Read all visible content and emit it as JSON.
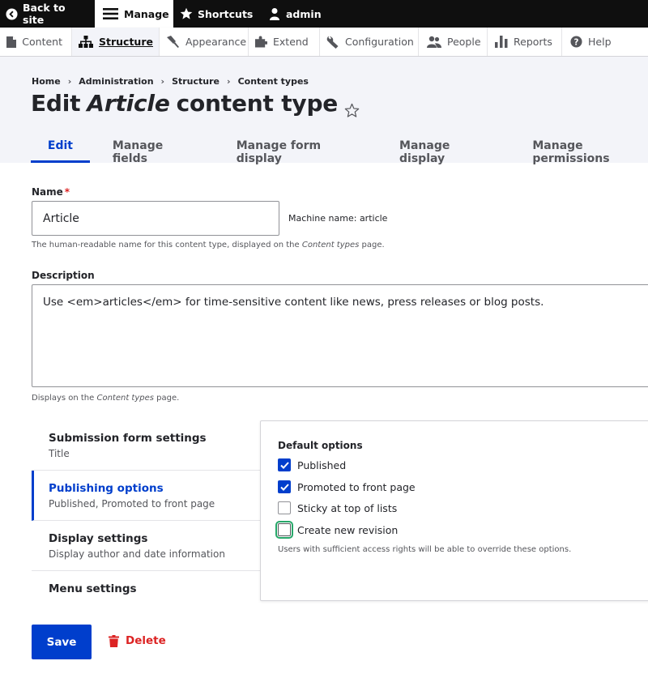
{
  "toolbar": {
    "back": "Back to site",
    "manage": "Manage",
    "shortcuts": "Shortcuts",
    "user": "admin"
  },
  "tray": {
    "items": [
      "Content",
      "Structure",
      "Appearance",
      "Extend",
      "Configuration",
      "People",
      "Reports",
      "Help"
    ]
  },
  "breadcrumb": [
    "Home",
    "Administration",
    "Structure",
    "Content types"
  ],
  "title": {
    "prefix": "Edit",
    "name": "Article",
    "suffix": "content type"
  },
  "tabs": [
    "Edit",
    "Manage fields",
    "Manage form display",
    "Manage display",
    "Manage permissions"
  ],
  "form": {
    "name_label": "Name",
    "name_required": "*",
    "name_value": "Article",
    "machine_name": "Machine name: article",
    "name_help_prefix": "The human-readable name for this content type, displayed on the",
    "name_help_em": "Content types",
    "name_help_suffix": "page.",
    "desc_label": "Description",
    "desc_value": "Use <em>articles</em> for time-sensitive content like news, press releases or blog posts.",
    "desc_help_prefix": "Displays on the",
    "desc_help_em": "Content types",
    "desc_help_suffix": "page."
  },
  "vertical_tabs": [
    {
      "title": "Submission form settings",
      "summary": "Title"
    },
    {
      "title": "Publishing options",
      "summary": "Published, Promoted to front page"
    },
    {
      "title": "Display settings",
      "summary": "Display author and date information"
    },
    {
      "title": "Menu settings",
      "summary": ""
    }
  ],
  "pane": {
    "title": "Default options",
    "options": [
      {
        "label": "Published",
        "checked": true
      },
      {
        "label": "Promoted to front page",
        "checked": true
      },
      {
        "label": "Sticky at top of lists",
        "checked": false
      },
      {
        "label": "Create new revision",
        "checked": false
      }
    ],
    "help": "Users with sufficient access rights will be able to override these options."
  },
  "actions": {
    "save": "Save",
    "delete": "Delete"
  },
  "colors": {
    "primary": "#003ecc",
    "danger": "#dc2323",
    "focus": "#26a769",
    "toolbar": "#0f0f0f"
  }
}
